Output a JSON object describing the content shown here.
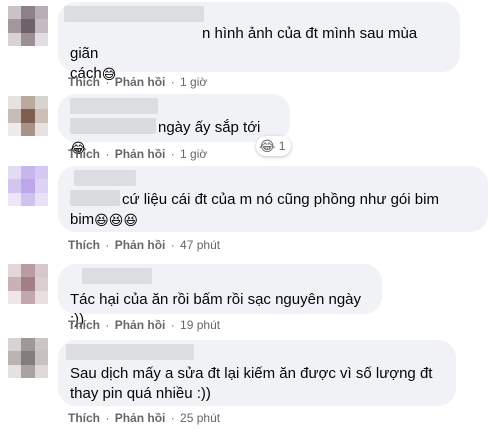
{
  "action_labels": {
    "like": "Thích",
    "reply": "Phản hồi",
    "separator": "·"
  },
  "comments": [
    {
      "line1": "n hình ảnh của đt mình sau mùa giãn",
      "line2": "cách",
      "emoji": "😅",
      "time": "1 giờ"
    },
    {
      "line1": "ngày ấy sắp tới",
      "emoji": "😂",
      "time": "1 giờ",
      "reaction_emoji": "😂",
      "reaction_count": "1"
    },
    {
      "line1": "cứ liệu cái đt của m nó cũng phồng như gói bim",
      "line2": "bim",
      "emoji": "😆😆😆",
      "time": "47 phút"
    },
    {
      "line1": "Tác hại của ăn rồi bấm rồi sạc nguyên ngày :))",
      "time": "19 phút"
    },
    {
      "line1": "Sau dịch mấy a sửa đt lại kiếm ăn được vì số lượng đt",
      "line2": "thay pin quá nhiều :))",
      "time": "25 phút"
    }
  ]
}
